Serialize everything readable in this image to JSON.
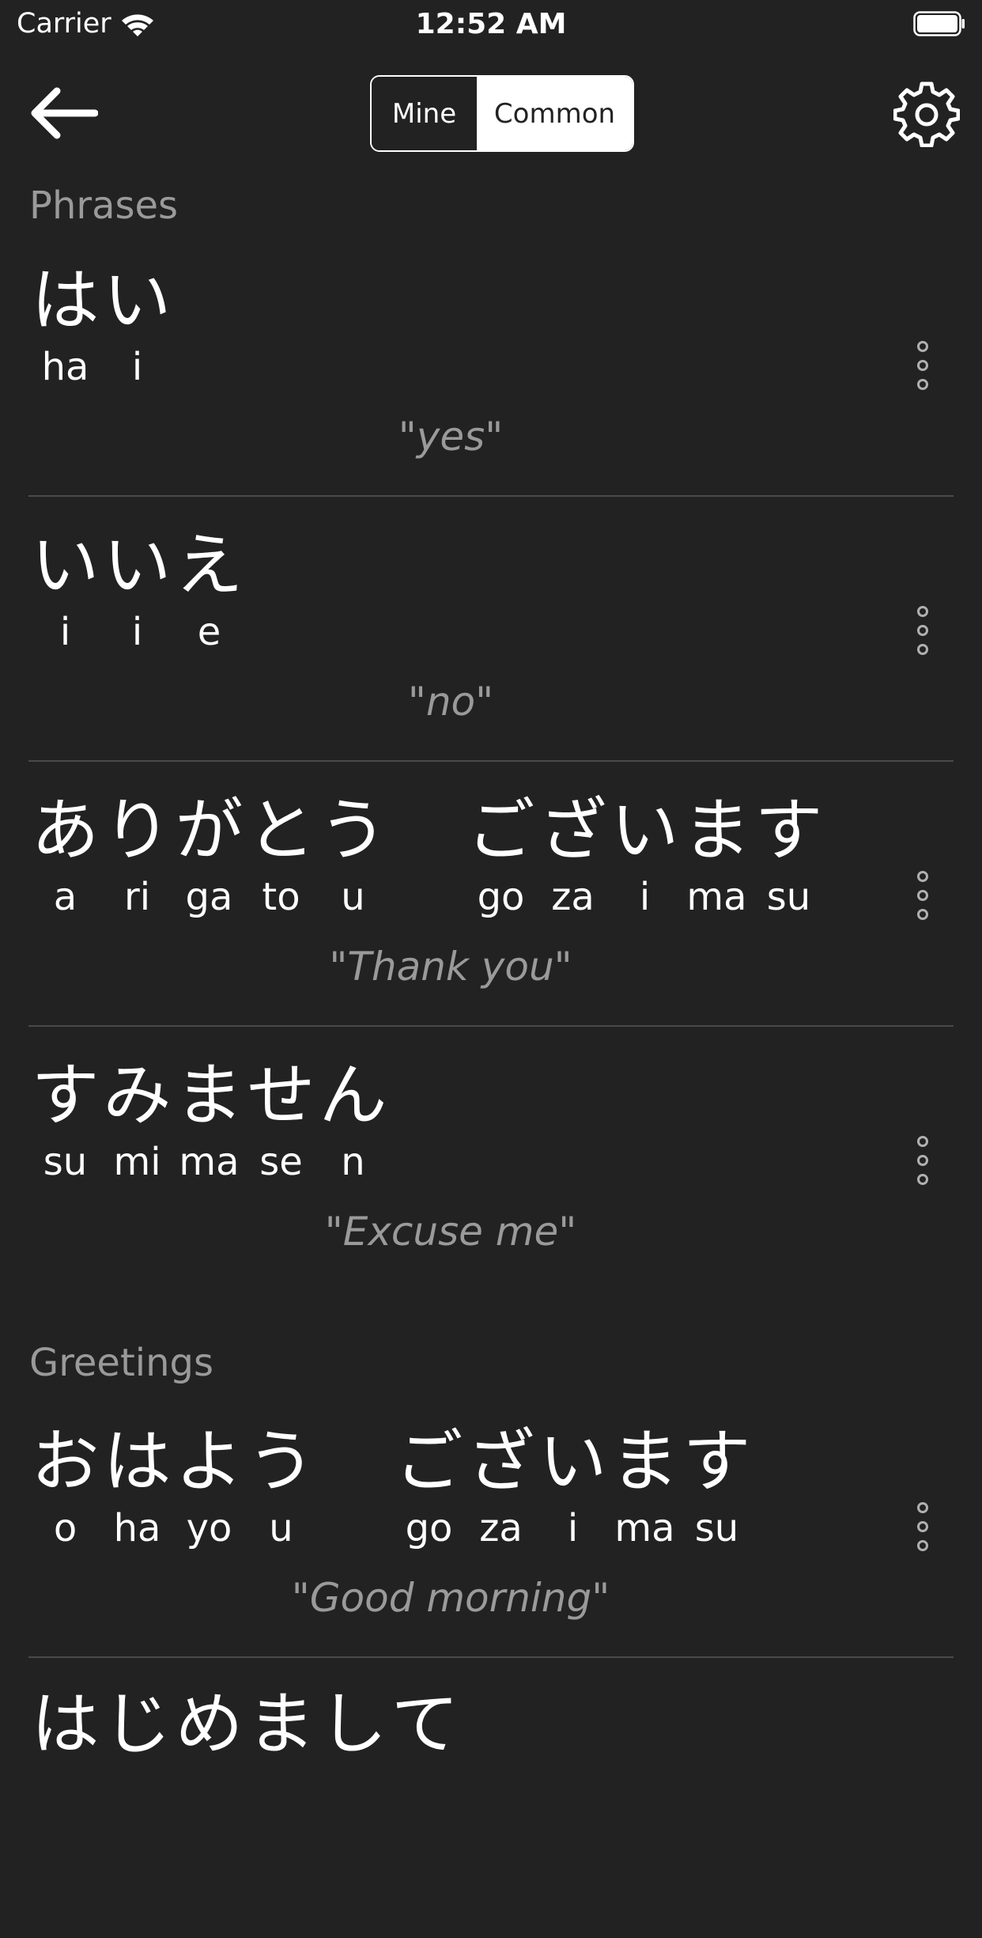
{
  "status_bar": {
    "carrier": "Carrier",
    "time": "12:52 AM"
  },
  "nav": {
    "segments": [
      "Mine",
      "Common"
    ],
    "selected_segment": "Common"
  },
  "sections": [
    {
      "title": "Phrases",
      "phrases": [
        {
          "words": [
            [
              [
                "は",
                "ha"
              ],
              [
                "い",
                "i"
              ]
            ]
          ],
          "translation": "\"yes\""
        },
        {
          "words": [
            [
              [
                "い",
                "i"
              ],
              [
                "い",
                "i"
              ],
              [
                "え",
                "e"
              ]
            ]
          ],
          "translation": "\"no\""
        },
        {
          "words": [
            [
              [
                "あ",
                "a"
              ],
              [
                "り",
                "ri"
              ],
              [
                "が",
                "ga"
              ],
              [
                "と",
                "to"
              ],
              [
                "う",
                "u"
              ]
            ],
            [
              [
                "ご",
                "go"
              ],
              [
                "ざ",
                "za"
              ],
              [
                "い",
                "i"
              ],
              [
                "ま",
                "ma"
              ],
              [
                "す",
                "su"
              ]
            ]
          ],
          "translation": "\"Thank you\""
        },
        {
          "words": [
            [
              [
                "す",
                "su"
              ],
              [
                "み",
                "mi"
              ],
              [
                "ま",
                "ma"
              ],
              [
                "せ",
                "se"
              ],
              [
                "ん",
                "n"
              ]
            ]
          ],
          "translation": "\"Excuse me\""
        }
      ]
    },
    {
      "title": "Greetings",
      "phrases": [
        {
          "words": [
            [
              [
                "お",
                "o"
              ],
              [
                "は",
                "ha"
              ],
              [
                "よ",
                "yo"
              ],
              [
                "う",
                "u"
              ]
            ],
            [
              [
                "ご",
                "go"
              ],
              [
                "ざ",
                "za"
              ],
              [
                "い",
                "i"
              ],
              [
                "ま",
                "ma"
              ],
              [
                "す",
                "su"
              ]
            ]
          ],
          "translation": "\"Good morning\""
        },
        {
          "words": [
            [
              [
                "は",
                ""
              ],
              [
                "じ",
                ""
              ],
              [
                "め",
                ""
              ],
              [
                "ま",
                ""
              ],
              [
                "し",
                ""
              ],
              [
                "て",
                ""
              ]
            ]
          ],
          "translation": ""
        }
      ]
    }
  ],
  "colors": {
    "background": "#222222",
    "text": "#ffffff",
    "secondary": "#9a9a9a",
    "divider": "#4a4a4a"
  },
  "icons": [
    "wifi-icon",
    "battery-icon",
    "back-arrow-icon",
    "gear-icon",
    "more-vertical-icon"
  ]
}
